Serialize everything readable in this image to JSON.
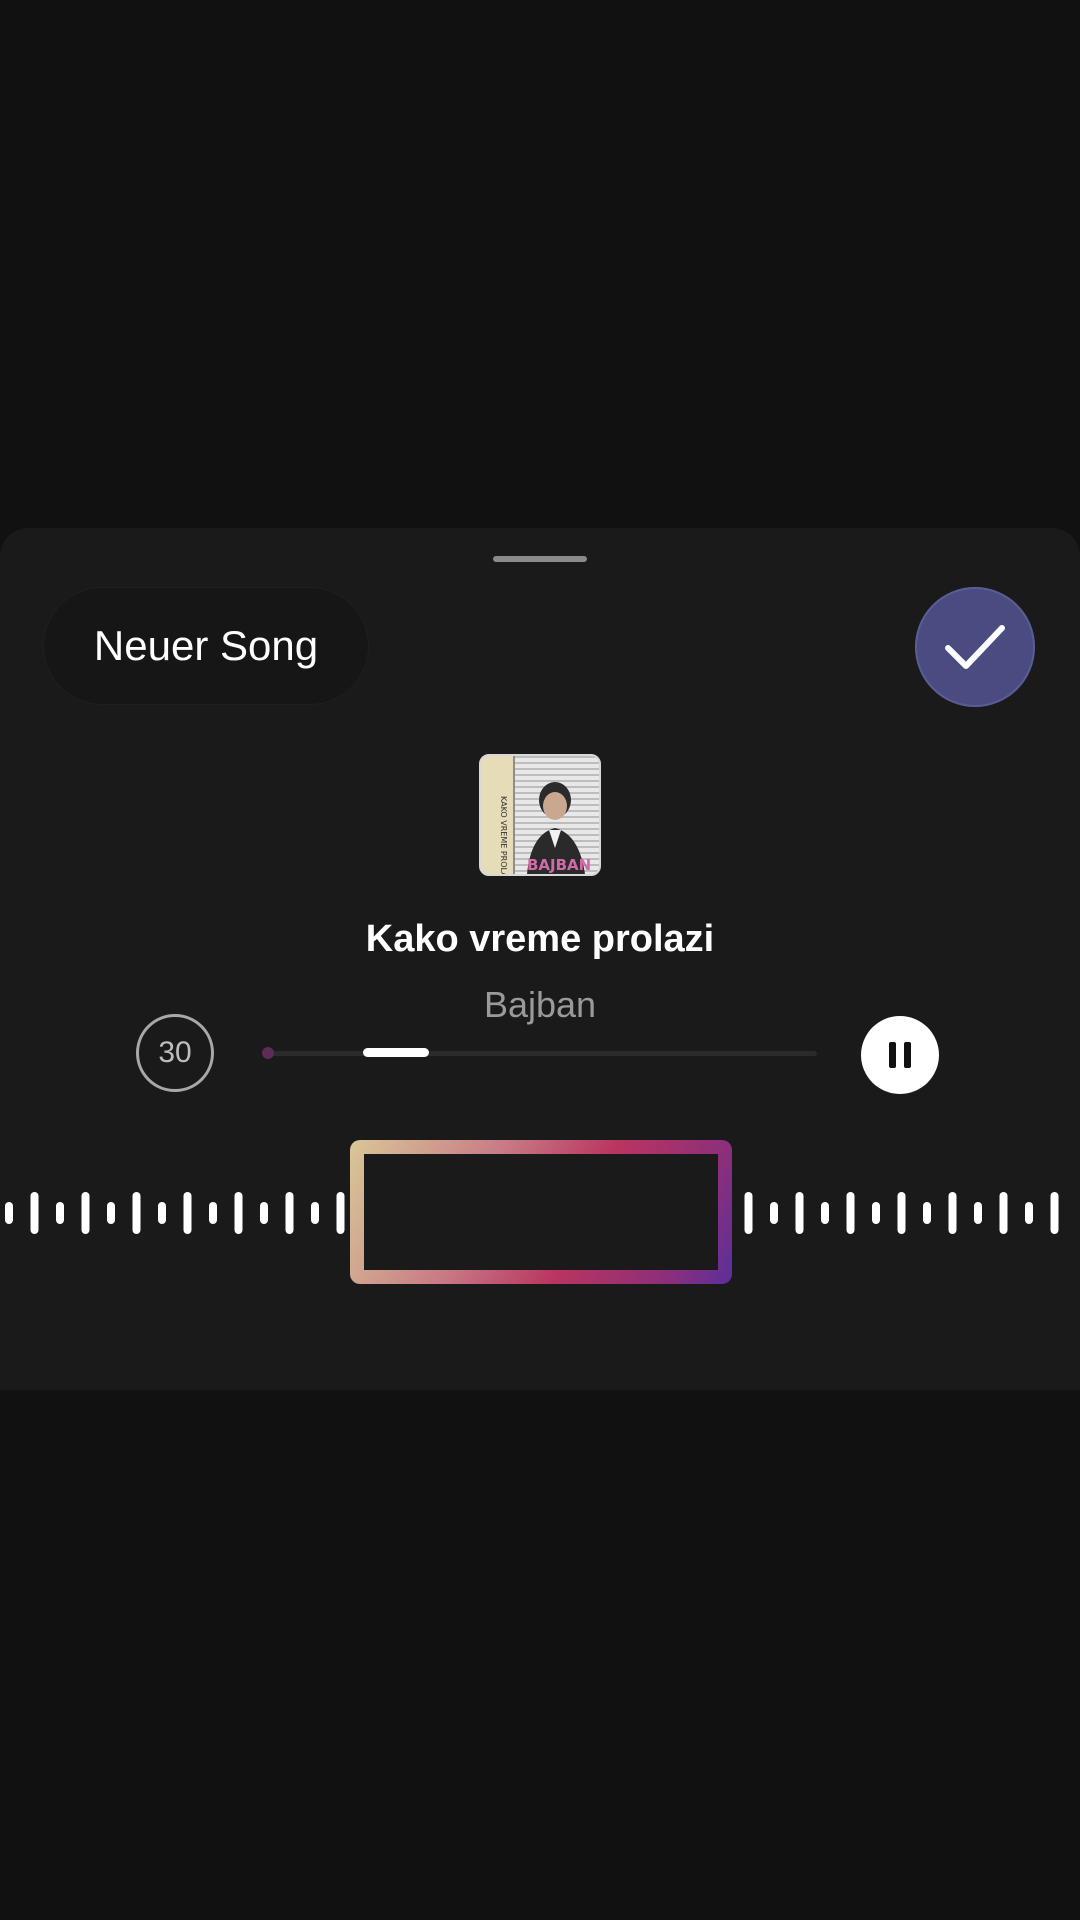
{
  "sheet": {
    "new_song_label": "Neuer Song"
  },
  "track": {
    "title": "Kako vreme prolazi",
    "artist": "Bajban",
    "album_text": "BAJBAN",
    "album_side_text": "KAKO VREME PROLAZI"
  },
  "controls": {
    "duration_label": "30",
    "progress_fraction": 0.27,
    "selection_length_fraction": 0.09
  },
  "colors": {
    "background": "#111111",
    "sheet": "#1a1a1a",
    "done_button": "#4a4b80",
    "selection_gradient": [
      "#d9c797",
      "#c77a86",
      "#b9355f",
      "#8b2f7b",
      "#5a2f9a"
    ]
  },
  "icons": {
    "done": "checkmark-icon",
    "pause": "pause-icon"
  }
}
